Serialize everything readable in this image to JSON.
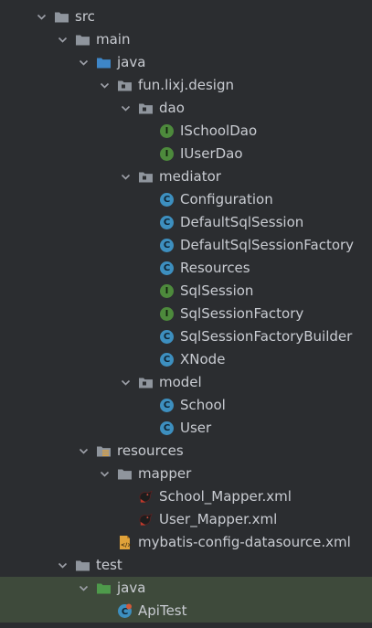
{
  "tree": [
    {
      "label": "src",
      "kind": "folder",
      "depth": 0,
      "expanded": true,
      "icon": "folder-icon"
    },
    {
      "label": "main",
      "kind": "folder",
      "depth": 1,
      "expanded": true,
      "icon": "folder-icon"
    },
    {
      "label": "java",
      "kind": "source-root",
      "depth": 2,
      "expanded": true,
      "icon": "source-folder-icon"
    },
    {
      "label": "fun.lixj.design",
      "kind": "package",
      "depth": 3,
      "expanded": true,
      "icon": "package-icon"
    },
    {
      "label": "dao",
      "kind": "package",
      "depth": 4,
      "expanded": true,
      "icon": "package-icon"
    },
    {
      "label": "ISchoolDao",
      "kind": "interface",
      "depth": 5,
      "icon": "interface-icon"
    },
    {
      "label": "IUserDao",
      "kind": "interface",
      "depth": 5,
      "icon": "interface-icon"
    },
    {
      "label": "mediator",
      "kind": "package",
      "depth": 4,
      "expanded": true,
      "icon": "package-icon"
    },
    {
      "label": "Configuration",
      "kind": "class",
      "depth": 5,
      "icon": "class-icon"
    },
    {
      "label": "DefaultSqlSession",
      "kind": "class",
      "depth": 5,
      "icon": "class-icon"
    },
    {
      "label": "DefaultSqlSessionFactory",
      "kind": "class",
      "depth": 5,
      "icon": "class-icon"
    },
    {
      "label": "Resources",
      "kind": "class",
      "depth": 5,
      "icon": "class-icon"
    },
    {
      "label": "SqlSession",
      "kind": "interface",
      "depth": 5,
      "icon": "interface-icon"
    },
    {
      "label": "SqlSessionFactory",
      "kind": "interface",
      "depth": 5,
      "icon": "interface-icon"
    },
    {
      "label": "SqlSessionFactoryBuilder",
      "kind": "class",
      "depth": 5,
      "icon": "class-icon"
    },
    {
      "label": "XNode",
      "kind": "class",
      "depth": 5,
      "icon": "class-icon"
    },
    {
      "label": "model",
      "kind": "package",
      "depth": 4,
      "expanded": true,
      "icon": "package-icon"
    },
    {
      "label": "School",
      "kind": "class",
      "depth": 5,
      "icon": "class-icon"
    },
    {
      "label": "User",
      "kind": "class",
      "depth": 5,
      "icon": "class-icon"
    },
    {
      "label": "resources",
      "kind": "resource-root",
      "depth": 2,
      "expanded": true,
      "icon": "resources-folder-icon"
    },
    {
      "label": "mapper",
      "kind": "folder",
      "depth": 3,
      "expanded": true,
      "icon": "folder-icon"
    },
    {
      "label": "School_Mapper.xml",
      "kind": "mybatis-xml",
      "depth": 4,
      "icon": "mybatis-icon"
    },
    {
      "label": "User_Mapper.xml",
      "kind": "mybatis-xml",
      "depth": 4,
      "icon": "mybatis-icon"
    },
    {
      "label": "mybatis-config-datasource.xml",
      "kind": "xml",
      "depth": 3,
      "icon": "xml-file-icon"
    },
    {
      "label": "test",
      "kind": "folder",
      "depth": 1,
      "expanded": true,
      "icon": "folder-icon"
    },
    {
      "label": "java",
      "kind": "test-root",
      "depth": 2,
      "expanded": true,
      "highlight": true,
      "icon": "test-folder-icon"
    },
    {
      "label": "ApiTest",
      "kind": "test-class",
      "depth": 3,
      "highlight": true,
      "icon": "test-class-icon"
    }
  ],
  "colors": {
    "background": "#2b2d30",
    "text": "#c9ccd2",
    "folder": "#8f959d",
    "source_root": "#3e86c8",
    "test_root": "#4e9a4b",
    "class": "#3d8fbf",
    "interface": "#4d8a3c",
    "highlight_row": "#3e4a3b"
  }
}
